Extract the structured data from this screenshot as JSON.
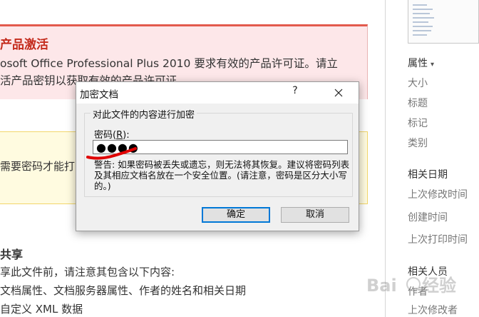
{
  "activation": {
    "title": "产品激活",
    "line1": "osoft Office Professional Plus 2010 要求有效的产品许可证。请立",
    "line2": "活产品密钥以获取有效的产品许可证。"
  },
  "warning_bar": {
    "text": "需要密码才能打"
  },
  "share": {
    "title": "共享",
    "line1": "享此文件前，请注意其包含以下内容:",
    "line2": "文档属性、文档服务器属性、作者的姓名和相关日期",
    "line3": "自定义 XML 数据"
  },
  "properties_pane": {
    "header": "属性",
    "items": [
      "大小",
      "标题",
      "标记",
      "类别"
    ],
    "dates_header": "相关日期",
    "date_items": [
      "上次修改时间",
      "创建时间",
      "上次打印时间"
    ],
    "people_header": "相关人员",
    "people_items": [
      "作者",
      "上次修改者"
    ]
  },
  "dialog": {
    "title": "加密文档",
    "help_label": "?",
    "group_label": "对此文件的内容进行加密",
    "password_label_prefix": "密码(",
    "password_label_key": "R",
    "password_label_suffix": "):",
    "password_value": "●●●●",
    "warning_text": "警告: 如果密码被丢失或遗忘，则无法将其恢复。建议将密码列表及其相应文档名放在一个安全位置。(请注意，密码是区分大小写的。)",
    "ok_label": "确定",
    "cancel_label": "取消"
  },
  "colors": {
    "activation_bg": "#fde7e9",
    "activation_accent": "#c42b1c",
    "warning_bg": "#fffbe0",
    "annotation_red": "#e00000",
    "ok_border": "#0078d7"
  },
  "watermark": {
    "text": "Baidu经验"
  }
}
